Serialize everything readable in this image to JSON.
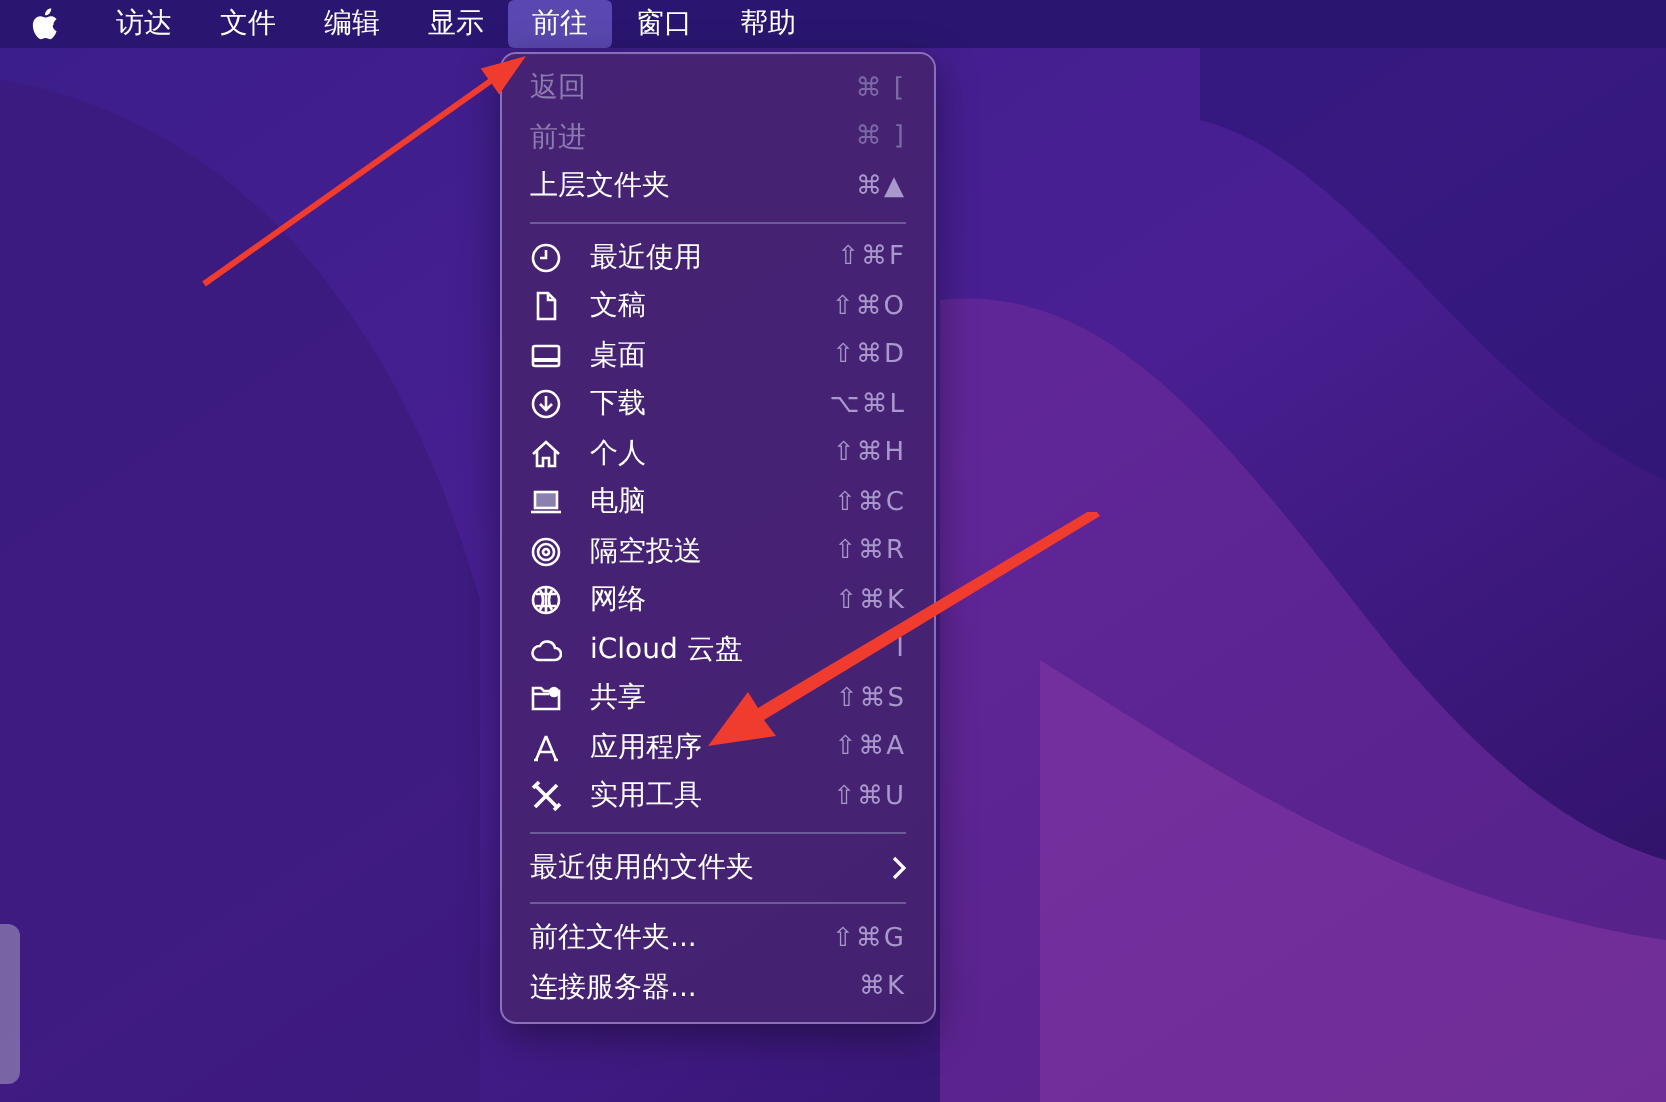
{
  "menubar": {
    "items": [
      {
        "label": "访达",
        "selected": false
      },
      {
        "label": "文件",
        "selected": false
      },
      {
        "label": "编辑",
        "selected": false
      },
      {
        "label": "显示",
        "selected": false
      },
      {
        "label": "前往",
        "selected": true
      },
      {
        "label": "窗口",
        "selected": false
      },
      {
        "label": "帮助",
        "selected": false
      }
    ]
  },
  "menu": {
    "sections": [
      {
        "items": [
          {
            "kind": "item",
            "label": "返回",
            "shortcut": "⌘ [",
            "disabled": true
          },
          {
            "kind": "item",
            "label": "前进",
            "shortcut": "⌘ ]",
            "disabled": true
          },
          {
            "kind": "item",
            "label": "上层文件夹",
            "shortcut": "⌘▲",
            "disabled": false
          }
        ]
      },
      {
        "items": [
          {
            "kind": "item",
            "label": "最近使用",
            "shortcut": "⇧⌘F",
            "disabled": false
          },
          {
            "kind": "item",
            "label": "文稿",
            "shortcut": "⇧⌘O",
            "disabled": false
          },
          {
            "kind": "item",
            "label": "桌面",
            "shortcut": "⇧⌘D",
            "disabled": false
          },
          {
            "kind": "item",
            "label": "下载",
            "shortcut": "⌥⌘L",
            "disabled": false
          },
          {
            "kind": "item",
            "label": "个人",
            "shortcut": "⇧⌘H",
            "disabled": false
          },
          {
            "kind": "item",
            "label": "电脑",
            "shortcut": "⇧⌘C",
            "disabled": false
          },
          {
            "kind": "item",
            "label": "隔空投送",
            "shortcut": "⇧⌘R",
            "disabled": false
          },
          {
            "kind": "item",
            "label": "网络",
            "shortcut": "⇧⌘K",
            "disabled": false
          },
          {
            "kind": "item",
            "label": "iCloud 云盘",
            "shortcut": "I",
            "disabled": false
          },
          {
            "kind": "item",
            "label": "共享",
            "shortcut": "⇧⌘S",
            "disabled": false
          },
          {
            "kind": "item",
            "label": "应用程序",
            "shortcut": "⇧⌘A",
            "disabled": false
          },
          {
            "kind": "item",
            "label": "实用工具",
            "shortcut": "⇧⌘U",
            "disabled": false
          }
        ]
      },
      {
        "items": [
          {
            "kind": "submenu",
            "label": "最近使用的文件夹",
            "disabled": false
          }
        ]
      },
      {
        "items": [
          {
            "kind": "item",
            "label": "前往文件夹...",
            "shortcut": "⇧⌘G",
            "disabled": false
          },
          {
            "kind": "item",
            "label": "连接服务器...",
            "shortcut": "⌘K",
            "disabled": false
          }
        ]
      }
    ]
  }
}
